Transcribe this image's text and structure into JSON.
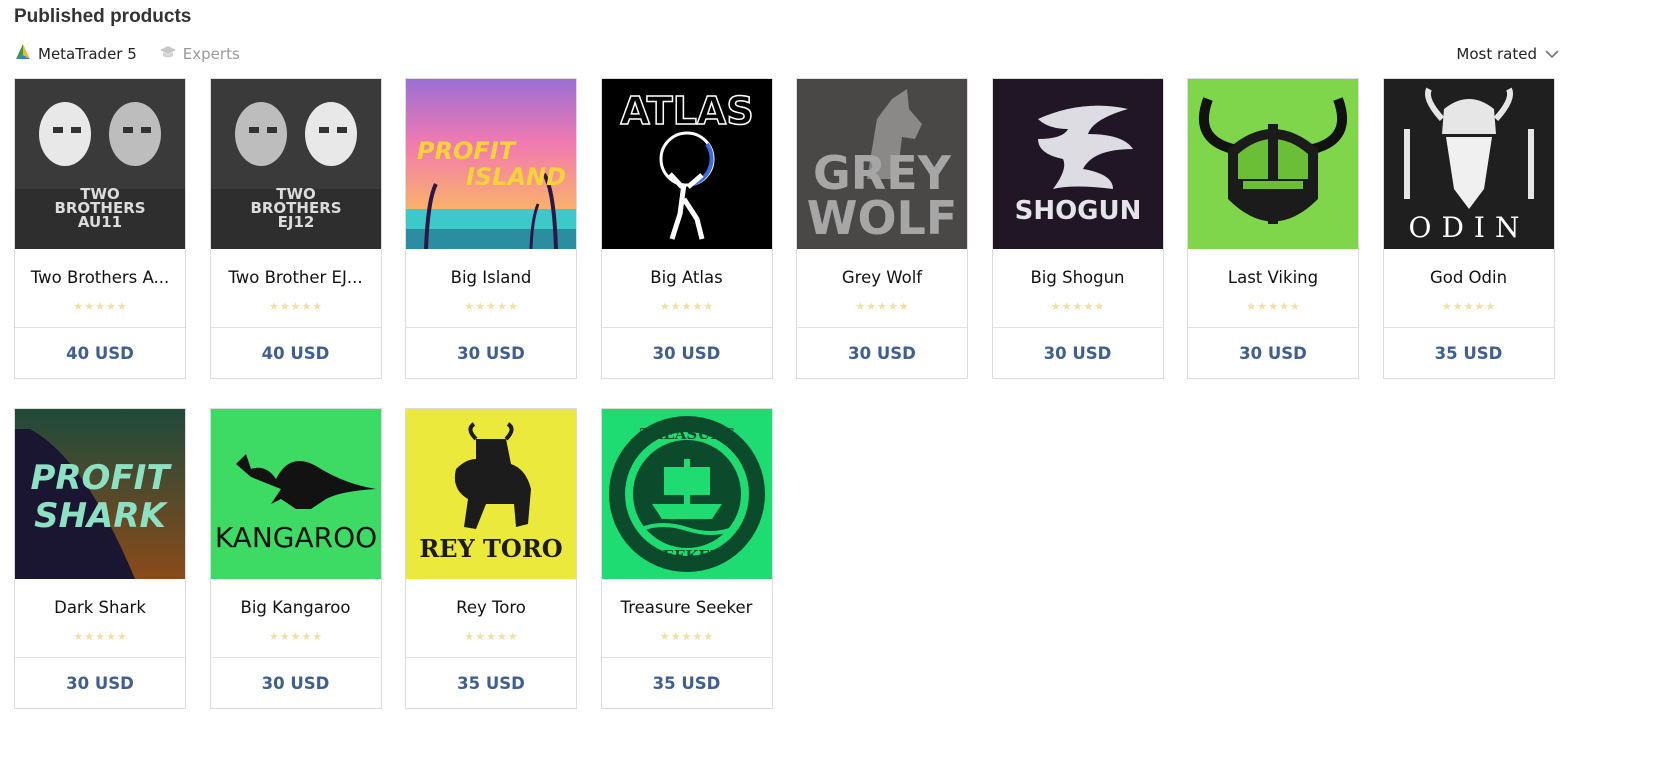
{
  "header": {
    "title": "Published products"
  },
  "filters": {
    "platform": {
      "label": "MetaTrader 5",
      "icon": "metatrader-icon"
    },
    "category": {
      "label": "Experts",
      "icon": "graduation-cap-icon"
    }
  },
  "sort": {
    "label": "Most rated",
    "icon": "chevron-down-icon"
  },
  "colors": {
    "price": "#3f5f91",
    "star": "#f3dfa0",
    "border": "#dcdcdc"
  },
  "products": [
    {
      "name": "Two Brothers A...",
      "price": "40 USD",
      "rating_stars": 5,
      "thumb": {
        "bg": "#3a3a3a",
        "caption": [
          "TWO",
          "BROTHERS",
          "AU11"
        ]
      }
    },
    {
      "name": "Two Brother EJ...",
      "price": "40 USD",
      "rating_stars": 5,
      "thumb": {
        "bg": "#3a3a3a",
        "caption": [
          "TWO",
          "BROTHERS",
          "EJ12"
        ]
      }
    },
    {
      "name": "Big Island",
      "price": "30 USD",
      "rating_stars": 5,
      "thumb": {
        "caption": [
          "PROFIT",
          "ISLAND"
        ]
      }
    },
    {
      "name": "Big Atlas",
      "price": "30 USD",
      "rating_stars": 5,
      "thumb": {
        "bg": "#000000",
        "caption": [
          "ATLAS"
        ]
      }
    },
    {
      "name": "Grey Wolf",
      "price": "30 USD",
      "rating_stars": 5,
      "thumb": {
        "bg": "#4a4847",
        "caption": [
          "GREY",
          "WOLF"
        ]
      }
    },
    {
      "name": "Big Shogun",
      "price": "30 USD",
      "rating_stars": 5,
      "thumb": {
        "bg": "#211626",
        "caption": [
          "SHOGUN"
        ]
      }
    },
    {
      "name": "Last Viking",
      "price": "30 USD",
      "rating_stars": 5,
      "thumb": {
        "bg": "#7fd64a"
      }
    },
    {
      "name": "God Odin",
      "price": "35 USD",
      "rating_stars": 5,
      "thumb": {
        "bg": "#1f1f1f",
        "caption": [
          "ODIN"
        ]
      }
    },
    {
      "name": "Dark Shark",
      "price": "30 USD",
      "rating_stars": 5,
      "thumb": {
        "caption": [
          "PROFIT",
          "SHARK"
        ]
      }
    },
    {
      "name": "Big Kangaroo",
      "price": "30 USD",
      "rating_stars": 5,
      "thumb": {
        "bg": "#3ddb63",
        "caption": [
          "KANGAROO"
        ]
      }
    },
    {
      "name": "Rey Toro",
      "price": "35 USD",
      "rating_stars": 5,
      "thumb": {
        "bg": "#ece93d",
        "caption": [
          "REY TORO"
        ]
      }
    },
    {
      "name": "Treasure Seeker",
      "price": "35 USD",
      "rating_stars": 5,
      "thumb": {
        "bg": "#1fdc72",
        "caption": [
          "TREASURE",
          "SEEKER"
        ]
      }
    }
  ]
}
